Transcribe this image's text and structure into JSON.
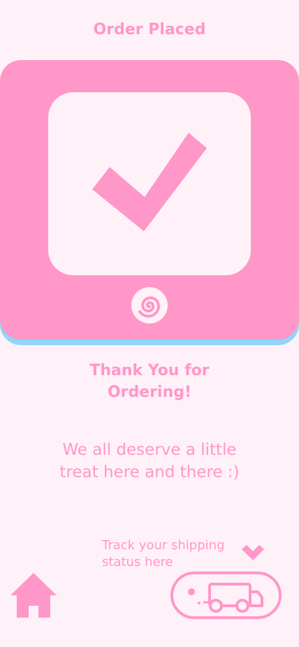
{
  "header": {
    "title": "Order Placed"
  },
  "hero": {
    "check_icon": "checkmark-icon",
    "swirl_icon": "swirl-icon"
  },
  "message": {
    "heading": "Thank You for\nOrdering!",
    "body": "We all deserve a little\ntreat here and there :)"
  },
  "tracking": {
    "hint": "Track your shipping\nstatus here",
    "chevron_icon": "chevron-down-icon",
    "button_icon": "truck-icon"
  },
  "nav": {
    "home_icon": "home-icon"
  },
  "colors": {
    "background": "#fff1f8",
    "pink": "#ff97c8",
    "blue": "#8fd6f7"
  }
}
